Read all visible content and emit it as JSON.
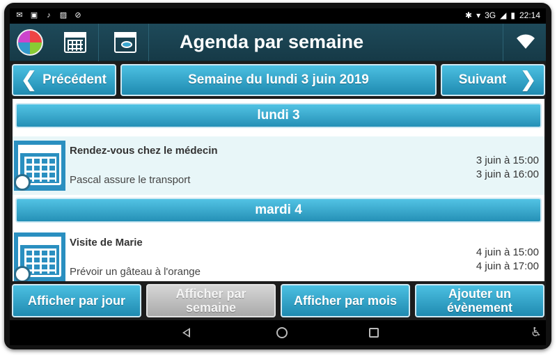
{
  "status": {
    "network": "3G",
    "time": "22:14"
  },
  "app": {
    "title": "Agenda par semaine"
  },
  "nav": {
    "prev_label": "Précédent",
    "week_label": "Semaine du lundi 3 juin 2019",
    "next_label": "Suivant"
  },
  "days": [
    {
      "label": "lundi 3",
      "events": [
        {
          "title": "Rendez-vous chez le médecin",
          "description": "Pascal assure le transport",
          "start": "3 juin à 15:00",
          "end": "3 juin à 16:00"
        }
      ]
    },
    {
      "label": "mardi 4",
      "events": [
        {
          "title": "Visite de Marie",
          "description": "Prévoir un gâteau à l'orange",
          "start": "4 juin à 15:00",
          "end": "4 juin à 17:00"
        }
      ]
    }
  ],
  "bottom": {
    "by_day": "Afficher par jour",
    "by_week_line1": "Afficher par",
    "by_week_line2": "semaine",
    "by_month": "Afficher par mois",
    "add_line1": "Ajouter un",
    "add_line2": "évènement"
  },
  "colors": {
    "accent": "#2ba3cc",
    "appbar": "#1e4a5a",
    "disabled": "#b5b5b5"
  },
  "icons": {
    "logo": "puzzle-globe-icon",
    "month_calendar": "calendar-icon",
    "week_calendar": "calendar-eye-icon",
    "wifi": "wifi-icon",
    "event": "calendar-alarm-icon"
  }
}
